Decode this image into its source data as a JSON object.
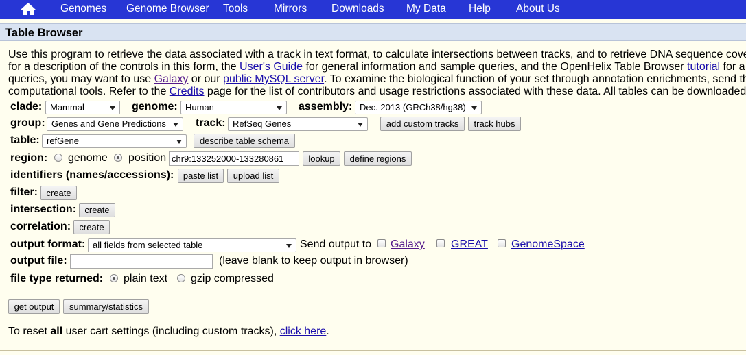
{
  "nav": {
    "home_icon": "home-icon",
    "items": [
      "Genomes",
      "Genome Browser",
      "Tools",
      "Mirrors",
      "Downloads",
      "My Data",
      "Help",
      "About Us"
    ]
  },
  "page_title": "Table Browser",
  "intro": {
    "l1": "Use this program to retrieve the data associated with a track in text format, to calculate intersections between tracks, and to retrieve DNA sequence cove",
    "l2a": "for a description of the controls in this form, the ",
    "l2_link": "User's Guide",
    "l2b": " for general information and sample queries, and the OpenHelix Table Browser ",
    "l2_link2": "tutorial",
    "l2c": " for a",
    "l3a": "queries, you may want to use ",
    "l3_link": "Galaxy",
    "l3b": " or our ",
    "l3_link2": "public MySQL server",
    "l3c": ". To examine the biological function of your set through annotation enrichments, send th",
    "l4a": "computational tools. Refer to the ",
    "l4_link": "Credits",
    "l4b": " page for the list of contributors and usage restrictions associated with these data. All tables can be downloaded"
  },
  "form": {
    "clade_label": "clade:",
    "clade_value": "Mammal",
    "genome_label": "genome:",
    "genome_value": "Human",
    "assembly_label": "assembly:",
    "assembly_value": "Dec. 2013 (GRCh38/hg38)",
    "group_label": "group:",
    "group_value": "Genes and Gene Predictions",
    "track_label": "track:",
    "track_value": "RefSeq Genes",
    "add_custom_tracks": "add custom tracks",
    "track_hubs": "track hubs",
    "table_label": "table:",
    "table_value": "refGene",
    "describe_schema": "describe table schema",
    "region_label": "region:",
    "region_genome": "genome",
    "region_position": "position",
    "position_value": "chr9:133252000-133280861",
    "lookup": "lookup",
    "define_regions": "define regions",
    "identifiers_label": "identifiers (names/accessions):",
    "paste_list": "paste list",
    "upload_list": "upload list",
    "filter_label": "filter:",
    "filter_create": "create",
    "intersection_label": "intersection:",
    "intersection_create": "create",
    "correlation_label": "correlation:",
    "correlation_create": "create",
    "output_format_label": "output format:",
    "output_format_value": "all fields from selected table",
    "send_output_to": "Send output to",
    "send_galaxy": "Galaxy",
    "send_great": "GREAT",
    "send_genomespace": "GenomeSpace",
    "output_file_label": "output file:",
    "output_file_value": "",
    "output_file_hint": "(leave blank to keep output in browser)",
    "file_type_label": "file type returned:",
    "file_type_plain": "plain text",
    "file_type_gzip": "gzip compressed",
    "get_output": "get output",
    "summary_statistics": "summary/statistics"
  },
  "reset": {
    "pre": "To reset ",
    "bold": "all",
    "mid": " user cart settings (including custom tracks), ",
    "link": "click here",
    "post": "."
  },
  "colors": {
    "nav_bg": "#2736d5",
    "title_bg": "#d9e3f2",
    "page_bg": "#fffeef",
    "link": "#1a0dab"
  }
}
